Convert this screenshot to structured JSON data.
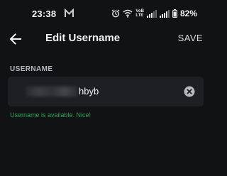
{
  "status_bar": {
    "time": "23:38",
    "network_top": "VoB",
    "network_bottom": "LTE",
    "battery_percent": "82%",
    "icons": [
      "m-notification-icon",
      "alarm-icon",
      "wifi-icon",
      "signal-icon",
      "signal-icon",
      "battery-icon"
    ]
  },
  "header": {
    "back_icon": "arrow-left-icon",
    "title": "Edit Username",
    "save_label": "SAVE"
  },
  "form": {
    "field_label": "USERNAME",
    "username_visible_suffix": "hbyb",
    "clear_icon": "clear-circle-icon",
    "availability_message": "Username is available. Nice!"
  },
  "colors": {
    "background": "#111214",
    "input_background": "#1e1f22",
    "success": "#23a55a",
    "text": "#f2f3f5",
    "muted": "#b5bac1"
  }
}
